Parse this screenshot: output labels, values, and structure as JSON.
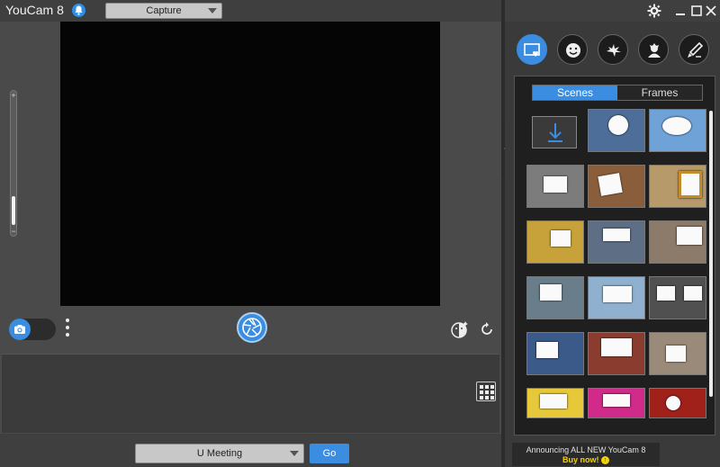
{
  "app": {
    "title": "YouCam 8",
    "mode_selected": "Capture",
    "icons": {
      "notification": "bell-icon",
      "settings": "gear-icon",
      "close": "close-icon",
      "maximize": "maximize-icon",
      "minimize": "minimize-icon"
    }
  },
  "preview": {
    "zoom_plus": "+",
    "zoom_minus": "−",
    "zoom_level": 0.2
  },
  "controls": {
    "camera_mode": "photo",
    "shutter_icon": "aperture-icon",
    "effects_icon": "face-effect-icon",
    "rotate_icon": "rotate-icon",
    "more_icon": "vertical-dots-icon"
  },
  "gallery": {
    "grid_icon": "grid-icon"
  },
  "bottom": {
    "meeting_selected": "U Meeting",
    "go_label": "Go"
  },
  "right_panel": {
    "tools": [
      {
        "name": "scene-frame-icon",
        "active": true
      },
      {
        "name": "smiley-icon",
        "active": false
      },
      {
        "name": "particle-icon",
        "active": false
      },
      {
        "name": "avatar-icon",
        "active": false
      },
      {
        "name": "brush-icon",
        "active": false
      }
    ],
    "tabs": {
      "scenes": "Scenes",
      "frames": "Frames",
      "active": "scenes"
    },
    "download_icon": "download-icon",
    "thumbnails": [
      {
        "bg": "#4d6e99"
      },
      {
        "bg": "#6fa2d6"
      },
      {
        "bg": "#7c7c7c"
      },
      {
        "bg": "#8a5e3a"
      },
      {
        "bg": "#b79a6a"
      },
      {
        "bg": "#c7a23a"
      },
      {
        "bg": "#5e6f85"
      },
      {
        "bg": "#8c7a6a"
      },
      {
        "bg": "#6a7d8a"
      },
      {
        "bg": "#8fb0cf"
      },
      {
        "bg": "#505050"
      },
      {
        "bg": "#3b5a8a"
      },
      {
        "bg": "#8a3d2e"
      },
      {
        "bg": "#9a8a7a"
      },
      {
        "bg": "#e6c83a"
      },
      {
        "bg": "#d02a8a"
      },
      {
        "bg": "#a0201a"
      }
    ],
    "colors": {
      "accent": "#3a8de0"
    }
  },
  "promo": {
    "line1": "Announcing ALL NEW YouCam 8",
    "line2": "Buy now!"
  }
}
